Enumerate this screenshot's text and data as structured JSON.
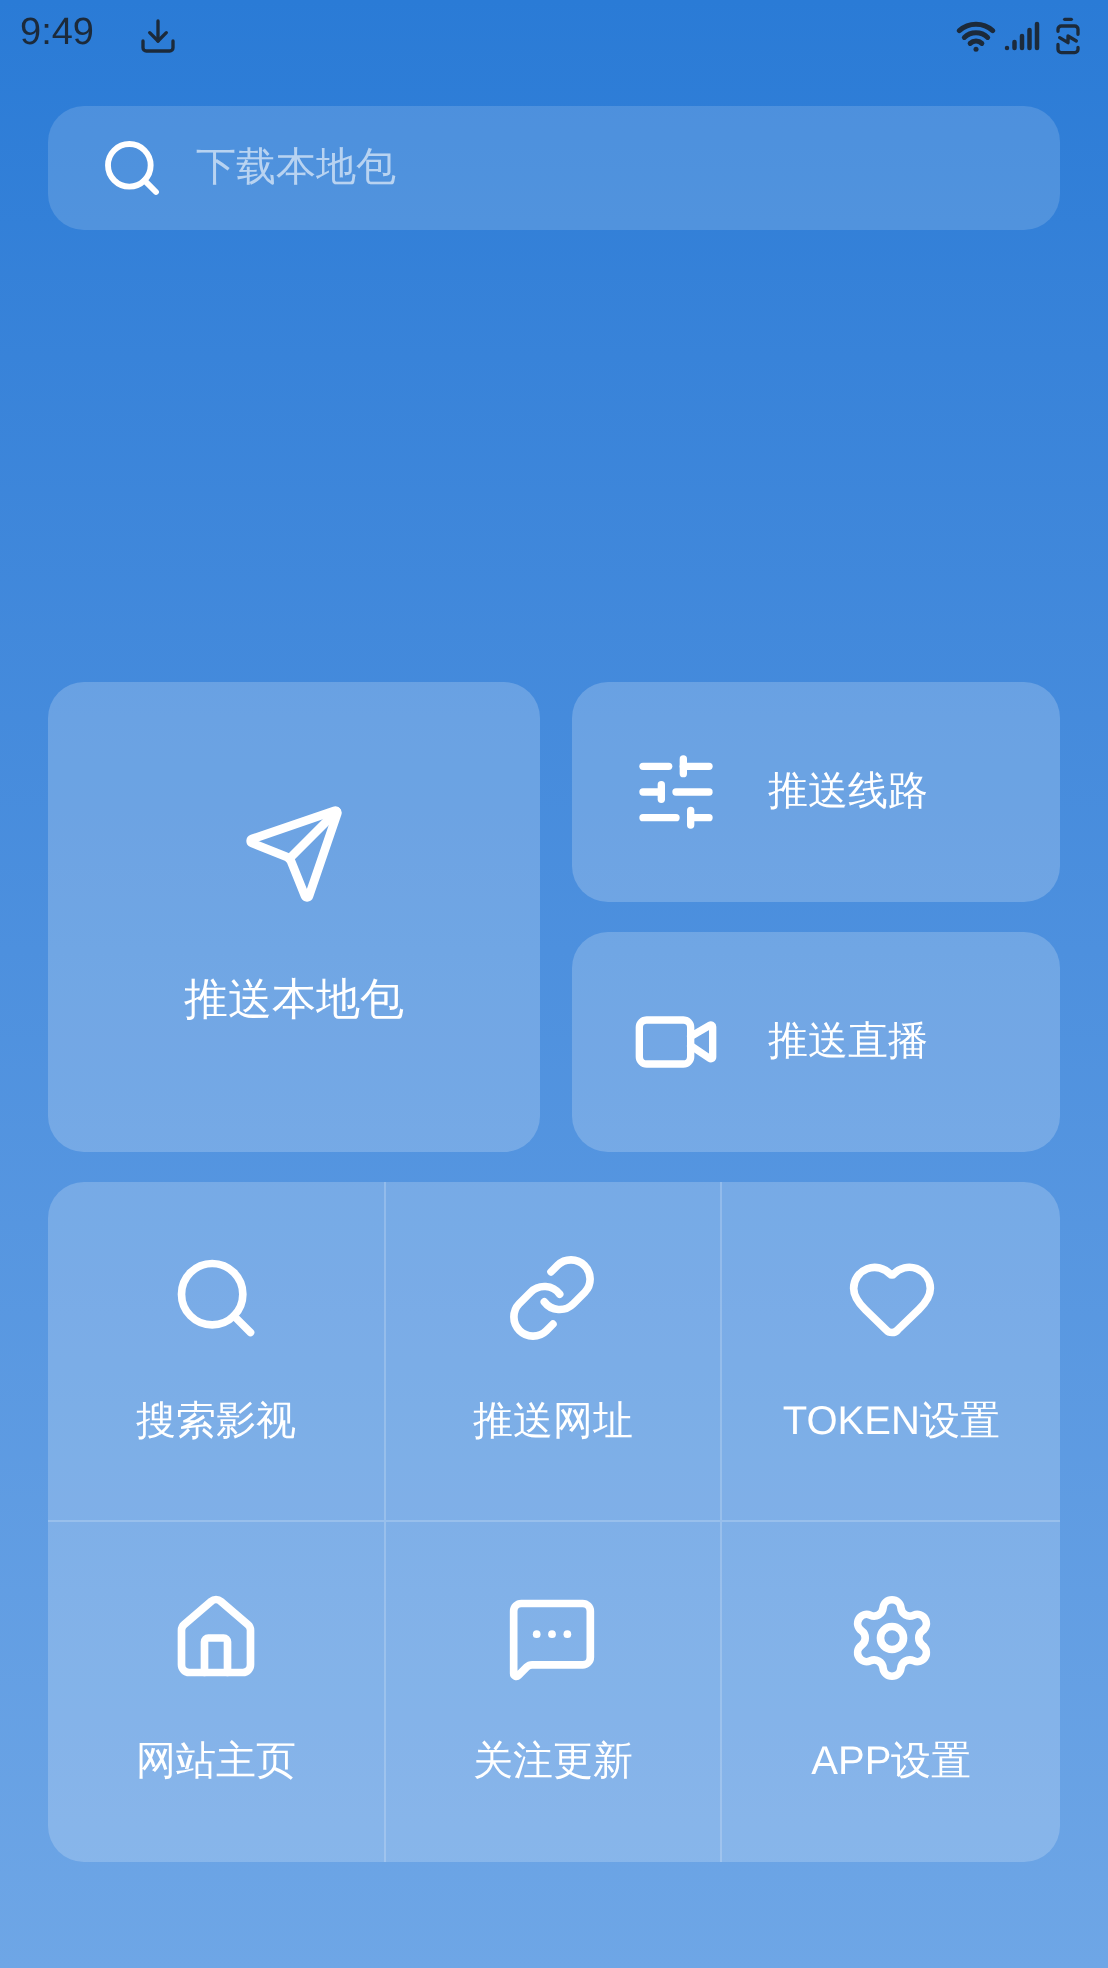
{
  "status_bar": {
    "time": "9:49"
  },
  "search": {
    "placeholder": "下载本地包"
  },
  "main_card": {
    "label": "推送本地包"
  },
  "side_cards": [
    {
      "label": "推送线路",
      "kind": "sliders"
    },
    {
      "label": "推送直播",
      "kind": "video"
    }
  ],
  "grid": [
    {
      "label": "搜索影视",
      "kind": "search"
    },
    {
      "label": "推送网址",
      "kind": "link"
    },
    {
      "label": "TOKEN设置",
      "kind": "heart"
    },
    {
      "label": "网站主页",
      "kind": "home"
    },
    {
      "label": "关注更新",
      "kind": "message"
    },
    {
      "label": "APP设置",
      "kind": "settings"
    }
  ]
}
